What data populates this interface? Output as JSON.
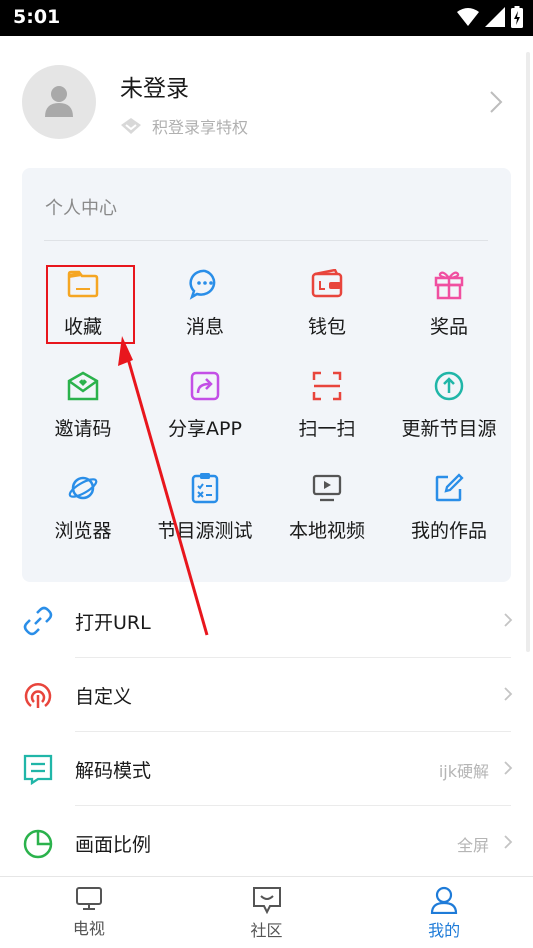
{
  "status": {
    "time": "5:01"
  },
  "profile": {
    "name": "未登录",
    "subtitle": "积登录享特权"
  },
  "center": {
    "title": "个人中心",
    "items": [
      {
        "label": "收藏",
        "icon": "folder-icon",
        "color": "#f5a623"
      },
      {
        "label": "消息",
        "icon": "message-icon",
        "color": "#2a8ee8"
      },
      {
        "label": "钱包",
        "icon": "wallet-icon",
        "color": "#e8453c"
      },
      {
        "label": "奖品",
        "icon": "gift-icon",
        "color": "#f04fa0"
      },
      {
        "label": "邀请码",
        "icon": "invite-envelope-icon",
        "color": "#2bb24c"
      },
      {
        "label": "分享APP",
        "icon": "share-icon",
        "color": "#c34fe6"
      },
      {
        "label": "扫一扫",
        "icon": "scan-icon",
        "color": "#e8453c"
      },
      {
        "label": "更新节目源",
        "icon": "update-upload-icon",
        "color": "#20b6a8"
      },
      {
        "label": "浏览器",
        "icon": "browser-planet-icon",
        "color": "#2a8ee8"
      },
      {
        "label": "节目源测试",
        "icon": "clipboard-test-icon",
        "color": "#2a8ee8"
      },
      {
        "label": "本地视频",
        "icon": "local-video-icon",
        "color": "#666666"
      },
      {
        "label": "我的作品",
        "icon": "edit-icon",
        "color": "#2a8ee8"
      }
    ]
  },
  "list": [
    {
      "label": "打开URL",
      "value": "",
      "icon": "link-icon",
      "color": "#2a8ee8"
    },
    {
      "label": "自定义",
      "value": "",
      "icon": "custom-podcast-icon",
      "color": "#e8453c"
    },
    {
      "label": "解码模式",
      "value": "ijk硬解",
      "icon": "decode-icon",
      "color": "#20b6a8"
    },
    {
      "label": "画面比例",
      "value": "全屏",
      "icon": "pie-ratio-icon",
      "color": "#2bb24c"
    }
  ],
  "tabs": [
    {
      "label": "电视",
      "icon": "tv-icon",
      "active": false
    },
    {
      "label": "社区",
      "icon": "community-chat-icon",
      "active": false
    },
    {
      "label": "我的",
      "icon": "profile-person-icon",
      "active": true
    }
  ],
  "colors": {
    "accent": "#1e7bd8",
    "highlight": "#e8161d",
    "card_bg": "#f2f5f9"
  }
}
